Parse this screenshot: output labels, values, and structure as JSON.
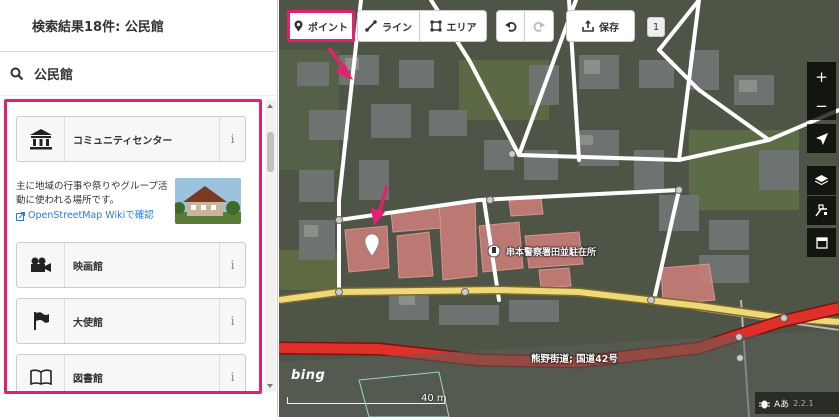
{
  "sidebar": {
    "header_title": "検索結果18件: 公民館",
    "search_value": "公民館",
    "presets": [
      {
        "label": "コミュニティセンター",
        "icon": "town-hall-icon"
      },
      {
        "label": "映画館",
        "icon": "movie-camera-icon"
      },
      {
        "label": "大使館",
        "icon": "flag-icon"
      },
      {
        "label": "図書館",
        "icon": "book-icon"
      }
    ],
    "info_glyph": "i",
    "description": "主に地域の行事や祭りやグループ活動に使われる場所です。",
    "wiki_link": "OpenStreetMap Wikiで確認"
  },
  "toolbar": {
    "point": "ポイント",
    "line": "ライン",
    "area": "エリア",
    "save": "保存",
    "save_count": "1"
  },
  "map": {
    "poi_label": "串本警察署田並駐在所",
    "road_label": "熊野街道; 国道42号",
    "attribution": "bing",
    "scale_label": "40 m",
    "lang_label": "Aあ",
    "version": "2.2.1",
    "colors": {
      "accent": "#e5206e",
      "primary_road": "#e0302a",
      "secondary_road": "#f0d878"
    }
  }
}
